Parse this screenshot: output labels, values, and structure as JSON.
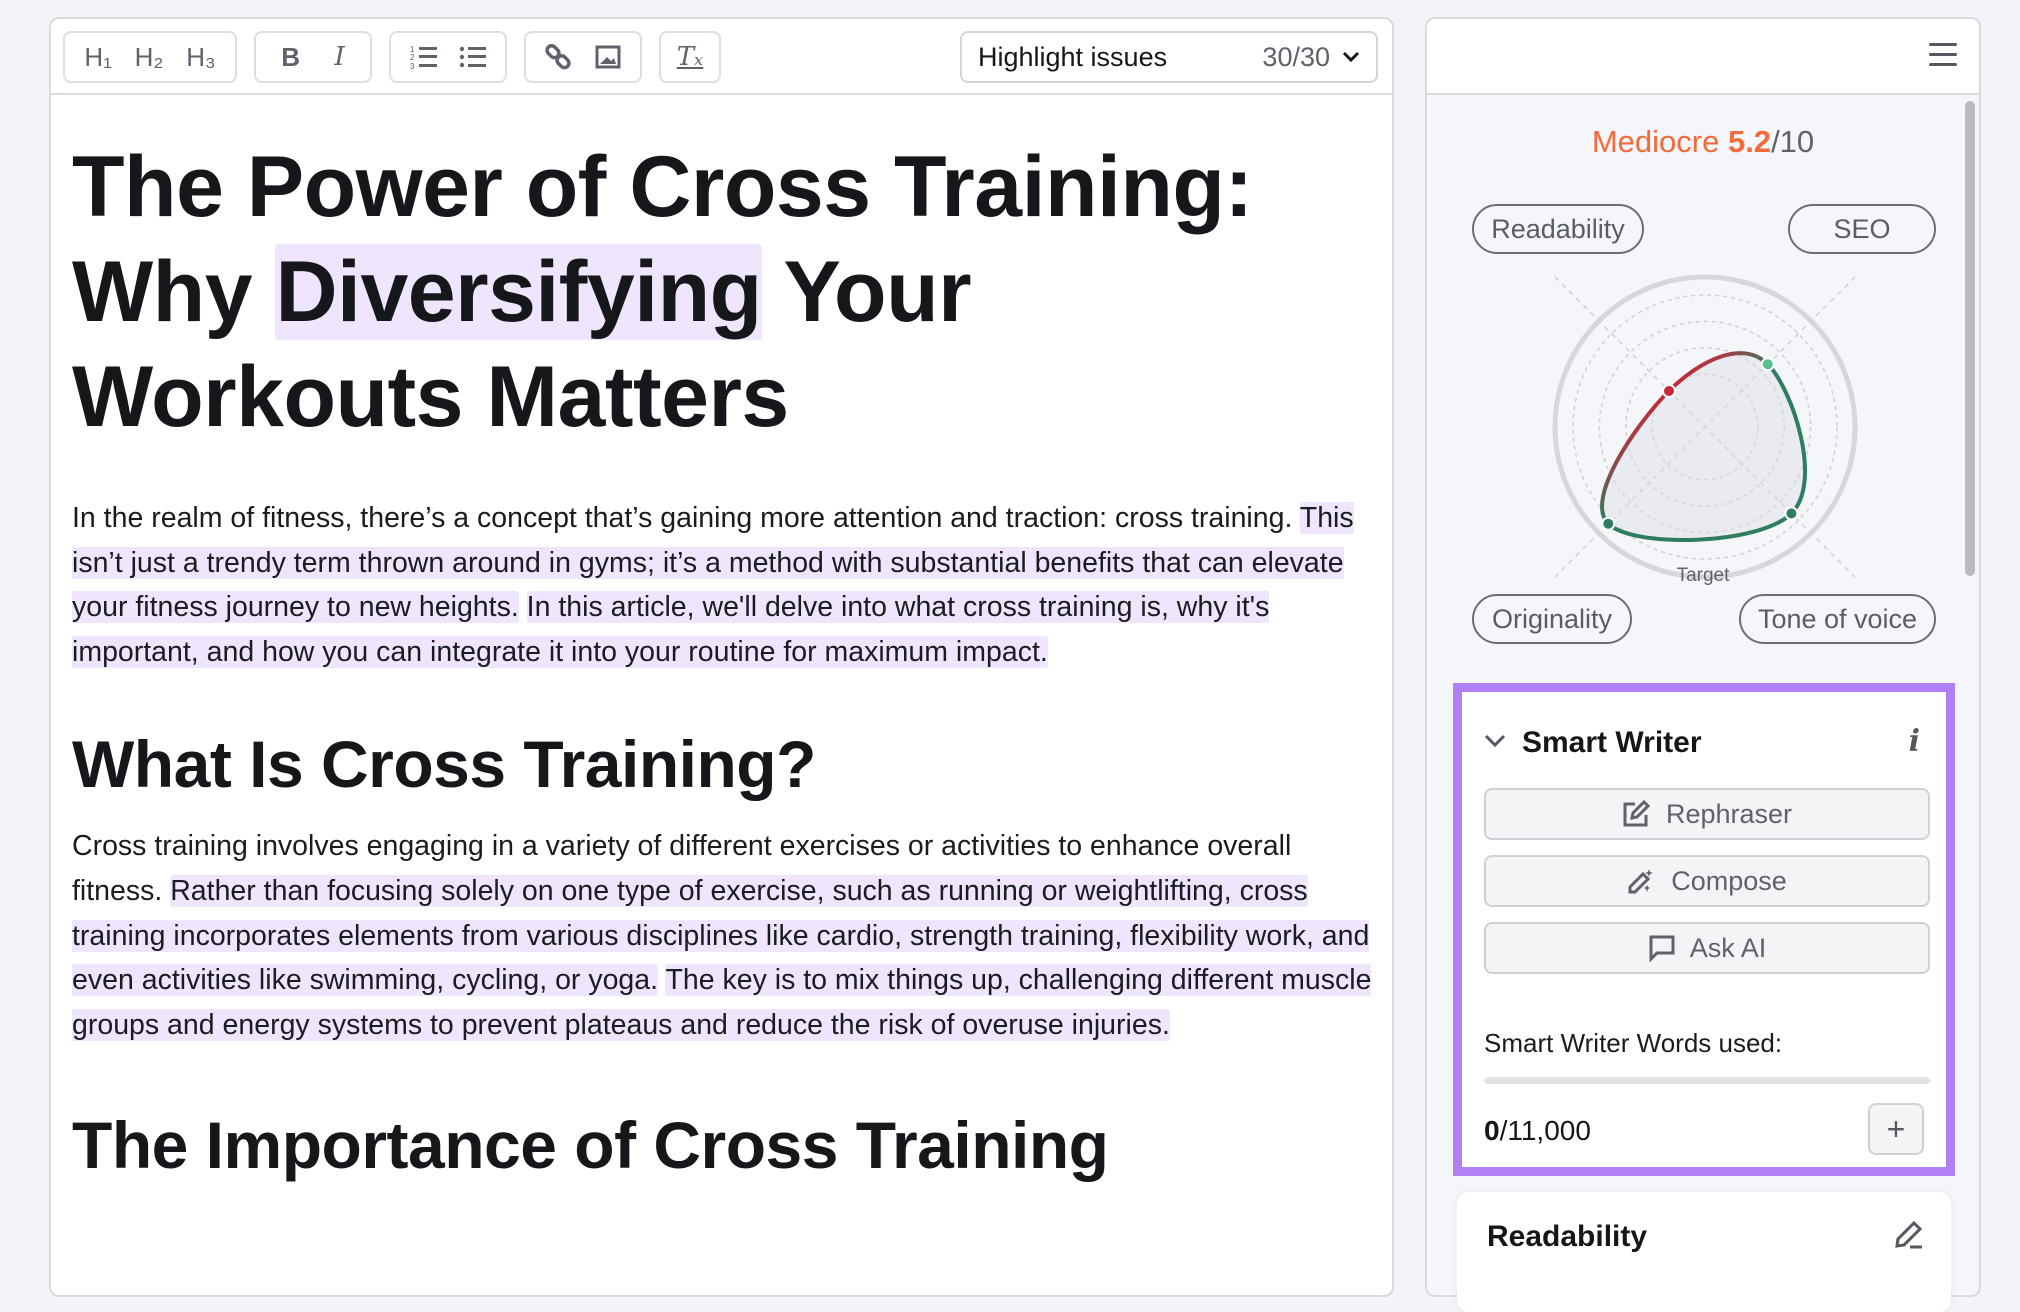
{
  "toolbar": {
    "h1": "H₁",
    "h2": "H₂",
    "h3": "H₃",
    "bold": "B",
    "italic": "I",
    "clear": "Tₓ",
    "highlight_label": "Highlight issues",
    "highlight_count": "30/30"
  },
  "article": {
    "title": {
      "before": "The Power of Cross Training: Why ",
      "highlight": "Diversifying",
      "after": " Your Workouts Matters"
    },
    "p1": [
      "In the realm of fitness, there’s a concept that’s gaining more attention and traction: cross training. ",
      "This isn’t just a trendy term thrown around in gyms; it’s a method with substantial benefits that can elevate your fitness journey to new heights.",
      " ",
      "In this article, we'll delve into what cross training is, why it's important, and how you can integrate it into your routine for maximum impact."
    ],
    "h2a": "What Is Cross Training?",
    "p2": [
      "Cross training involves engaging in a variety of different exercises or activities to enhance overall fitness. ",
      "Rather than focusing solely on one type of exercise, such as running or weightlifting, cross training incorporates elements from various disciplines like cardio, strength training, flexibility work, and even activities like swimming, cycling, or yoga.",
      " ",
      "The key is to mix things up, challenging different muscle groups and energy systems to prevent plateaus and reduce the risk of overuse injuries."
    ],
    "h2b": "The Importance of Cross Training"
  },
  "sidebar": {
    "score_label": "Mediocre",
    "score": "5.2",
    "score_max": "/10",
    "radar": {
      "target_label": "Target",
      "axes": [
        "Readability",
        "SEO",
        "Tone of voice",
        "Originality"
      ],
      "values": [
        0.35,
        0.61,
        0.84,
        0.94
      ]
    },
    "smart_writer": {
      "title": "Smart Writer",
      "rephraser": "Rephraser",
      "compose": "Compose",
      "ask_ai": "Ask AI",
      "words_label": "Smart Writer Words used:",
      "used": "0",
      "limit": "/11,000",
      "progress": 0
    },
    "readability_card": "Readability"
  },
  "colors": {
    "accent": "#b280f6",
    "score": "#f26b3a",
    "highlight": "#efe5fd",
    "good": "#2e7d5f",
    "bad": "#c8283a"
  }
}
